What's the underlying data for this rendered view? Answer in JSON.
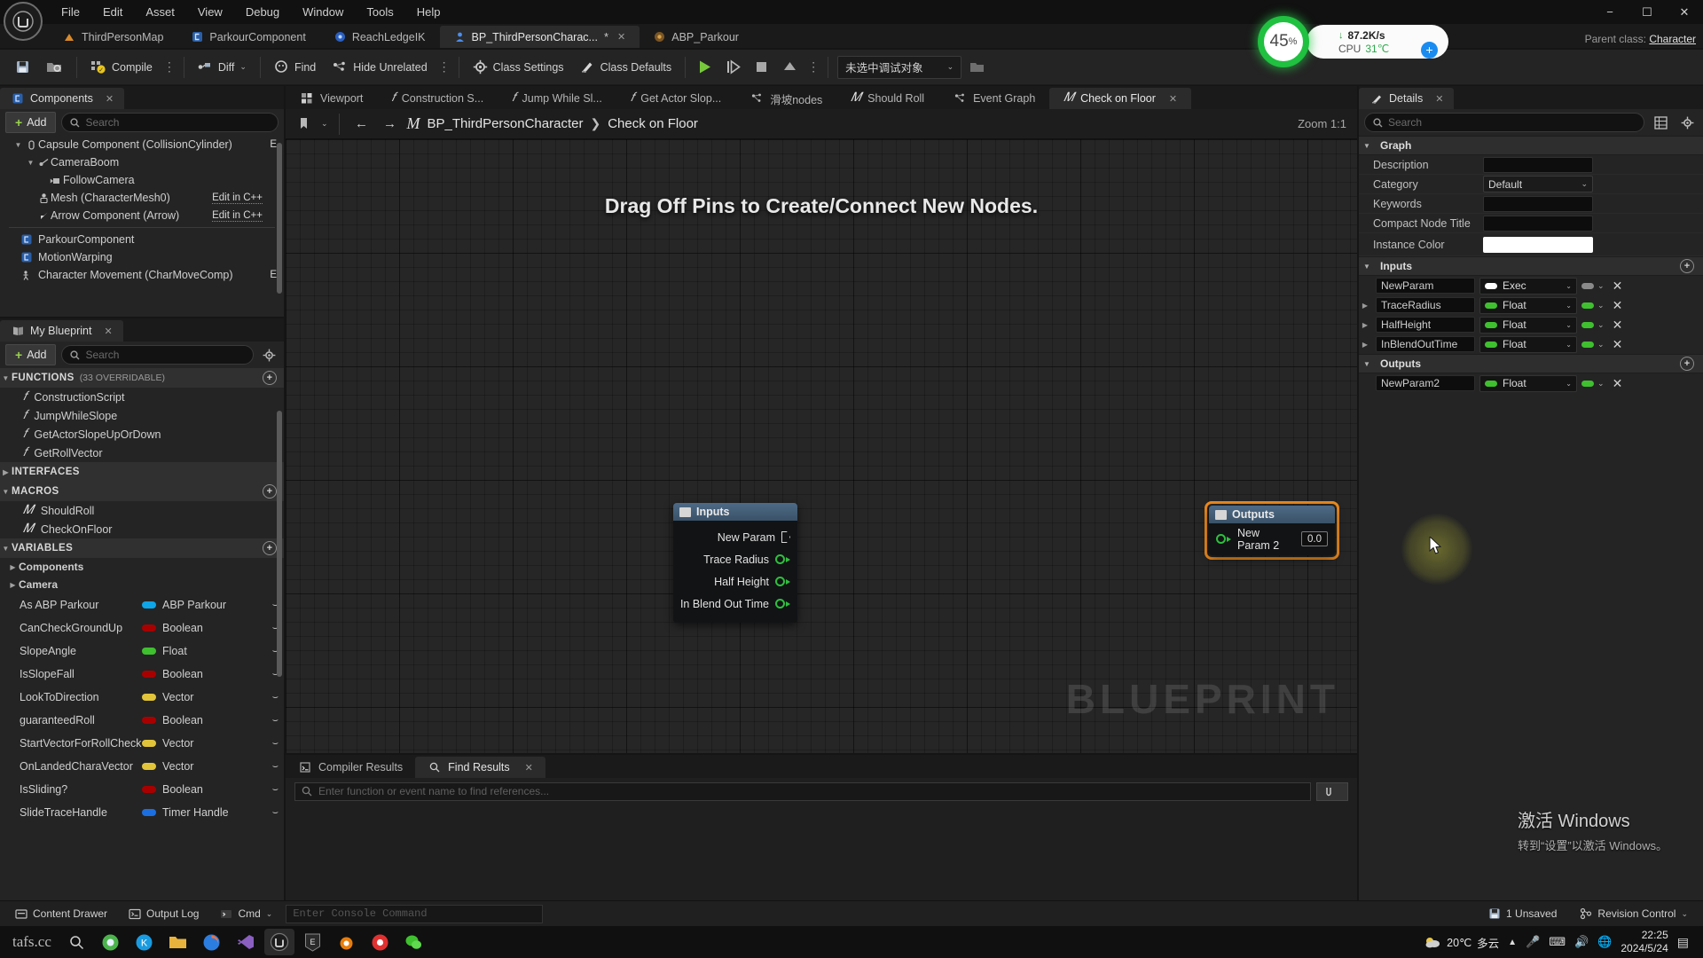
{
  "window": {
    "menu": [
      "File",
      "Edit",
      "Asset",
      "View",
      "Debug",
      "Window",
      "Tools",
      "Help"
    ],
    "minimize": "−",
    "maximize": "☐",
    "close": "✕"
  },
  "asset_tabs": [
    {
      "label": "ThirdPersonMap",
      "icon": "map-icon",
      "active": false,
      "dirty": false
    },
    {
      "label": "ParkourComponent",
      "icon": "blueprint-icon",
      "active": false,
      "dirty": false
    },
    {
      "label": "ReachLedgeIK",
      "icon": "animation-icon",
      "active": false,
      "dirty": false
    },
    {
      "label": "BP_ThirdPersonCharac...",
      "icon": "character-icon",
      "active": true,
      "dirty": true,
      "dirty_mark": "*",
      "close": "✕"
    },
    {
      "label": "ABP_Parkour",
      "icon": "anim-bp-icon",
      "active": false,
      "dirty": false
    }
  ],
  "parent_class": {
    "label": "Parent class:",
    "value": "Character"
  },
  "perf_widget": {
    "cpu_percent": "45",
    "percent_symbol": "%",
    "net_speed": "87.2K/s",
    "net_arrow": "↓",
    "cpu_label": "CPU",
    "cpu_temp": "31℃",
    "plus": "+"
  },
  "toolbar": {
    "save_icon": "save-icon",
    "browse_icon": "browse-content-icon",
    "compile": "Compile",
    "diff": "Diff",
    "find": "Find",
    "hide_unrelated": "Hide Unrelated",
    "class_settings": "Class Settings",
    "class_defaults": "Class Defaults",
    "kebab": "⋮",
    "chevron": "⌄",
    "play": "▶",
    "step": "⏯",
    "stop": "■",
    "eject": "▲",
    "debug_object": "未选中调试对象"
  },
  "components_panel": {
    "tab_label": "Components",
    "tab_close": "✕",
    "add_label": "Add",
    "add_plus": "+",
    "search_placeholder": "Search",
    "items": [
      {
        "label": "Capsule Component (CollisionCylinder)",
        "indent": 1,
        "twisty": "▼",
        "icon": "capsule-icon",
        "edit": "E"
      },
      {
        "label": "CameraBoom",
        "indent": 2,
        "twisty": "▼",
        "icon": "spring-arm-icon",
        "edit": ""
      },
      {
        "label": "FollowCamera",
        "indent": 3,
        "twisty": "",
        "icon": "camera-icon",
        "edit": ""
      },
      {
        "label": "Mesh (CharacterMesh0)",
        "indent": 2,
        "twisty": "",
        "icon": "skeletal-mesh-icon",
        "edit": "Edit in C++"
      },
      {
        "label": "Arrow Component (Arrow)",
        "indent": 2,
        "twisty": "",
        "icon": "arrow-icon",
        "edit": "Edit in C++"
      }
    ],
    "items2": [
      {
        "label": "ParkourComponent",
        "indent": 1,
        "icon": "blueprint-icon",
        "edit": ""
      },
      {
        "label": "MotionWarping",
        "indent": 1,
        "icon": "blueprint-icon",
        "edit": ""
      },
      {
        "label": "Character Movement (CharMoveComp)",
        "indent": 1,
        "icon": "movement-icon",
        "edit": "E"
      }
    ]
  },
  "myblueprint_panel": {
    "tab_label": "My Blueprint",
    "tab_close": "✕",
    "add_label": "Add",
    "add_plus": "+",
    "search_placeholder": "Search",
    "gear_icon": "gear-icon",
    "sections": [
      {
        "title": "FUNCTIONS",
        "sub": "(33 OVERRIDABLE)",
        "caret": "▼",
        "add": "+",
        "items": [
          {
            "label": "ConstructionScript",
            "icon": "f-italic"
          },
          {
            "label": "JumpWhileSlope",
            "icon": "f-italic"
          },
          {
            "label": "GetActorSlopeUpOrDown",
            "icon": "f-italic"
          },
          {
            "label": "GetRollVector",
            "icon": "f-italic"
          }
        ]
      },
      {
        "title": "INTERFACES",
        "sub": "",
        "caret": "▶",
        "add": "",
        "items": []
      },
      {
        "title": "MACROS",
        "sub": "",
        "caret": "▼",
        "add": "+",
        "items": [
          {
            "label": "ShouldRoll",
            "icon": "m-italic"
          },
          {
            "label": "CheckOnFloor",
            "icon": "m-italic"
          }
        ]
      }
    ],
    "variables_header": {
      "title": "VARIABLES",
      "caret": "▼",
      "add": "+"
    },
    "var_groups": [
      {
        "label": "Components",
        "caret": "▶"
      },
      {
        "label": "Camera",
        "caret": "▶"
      }
    ],
    "variables": [
      {
        "name": "As ABP Parkour",
        "type": "ABP Parkour",
        "color": "#0ea5e9",
        "eye": "⌣"
      },
      {
        "name": "CanCheckGroundUp",
        "type": "Boolean",
        "color": "#a80000",
        "eye": "⌣"
      },
      {
        "name": "SlopeAngle",
        "type": "Float",
        "color": "#3fc02f",
        "eye": "⌣"
      },
      {
        "name": "IsSlopeFall",
        "type": "Boolean",
        "color": "#a80000",
        "eye": "⌣"
      },
      {
        "name": "LookToDirection",
        "type": "Vector",
        "color": "#e2c43a",
        "eye": "⌣"
      },
      {
        "name": "guaranteedRoll",
        "type": "Boolean",
        "color": "#a80000",
        "eye": "⌣"
      },
      {
        "name": "StartVectorForRollCheck",
        "type": "Vector",
        "color": "#e2c43a",
        "eye": "⌣"
      },
      {
        "name": "OnLandedCharaVector",
        "type": "Vector",
        "color": "#e2c43a",
        "eye": "⌣"
      },
      {
        "name": "IsSliding?",
        "type": "Boolean",
        "color": "#a80000",
        "eye": "⌣"
      },
      {
        "name": "SlideTraceHandle",
        "type": "Timer Handle",
        "color": "#1c6fe0",
        "eye": "⌣"
      }
    ]
  },
  "graph_tabs": [
    {
      "label": "Viewport",
      "icon": "viewport-icon",
      "active": false
    },
    {
      "label": "Construction S...",
      "icon": "f-italic",
      "active": false
    },
    {
      "label": "Jump While Sl...",
      "icon": "f-italic",
      "active": false
    },
    {
      "label": "Get Actor Slop...",
      "icon": "f-italic",
      "active": false
    },
    {
      "label": "滑坡nodes",
      "icon": "graph-icon",
      "active": false
    },
    {
      "label": "Should Roll",
      "icon": "m-italic",
      "active": false
    },
    {
      "label": "Event Graph",
      "icon": "graph-icon",
      "active": false
    },
    {
      "label": "Check on Floor",
      "icon": "m-italic",
      "active": true,
      "close": "✕"
    }
  ],
  "graph_nav": {
    "bookmark_icon": "bookmark-icon",
    "chevron": "⌄",
    "back": "←",
    "forward": "→",
    "macro_icon": "M",
    "breadcrumb_root": "BP_ThirdPersonCharacter",
    "breadcrumb_sep": "❯",
    "breadcrumb_leaf": "Check on Floor",
    "zoom_label": "Zoom 1:1"
  },
  "graph": {
    "hint": "Drag Off Pins to Create/Connect New Nodes.",
    "watermark": "BLUEPRINT",
    "inputs_node": {
      "title": "Inputs",
      "pins": [
        {
          "label": "New Param",
          "pin": "exec"
        },
        {
          "label": "Trace Radius",
          "pin": "float"
        },
        {
          "label": "Half Height",
          "pin": "float"
        },
        {
          "label": "In Blend Out Time",
          "pin": "float"
        }
      ]
    },
    "outputs_node": {
      "title": "Outputs",
      "selected": true,
      "pins": [
        {
          "label": "New Param 2",
          "pin": "float",
          "value": "0.0"
        }
      ]
    }
  },
  "results_panel": {
    "tabs": [
      {
        "label": "Compiler Results",
        "icon": "compiler-icon",
        "active": false
      },
      {
        "label": "Find Results",
        "icon": "search-icon",
        "active": true,
        "close": "✕"
      }
    ],
    "find_placeholder": "Enter function or event name to find references...",
    "find_button_icon": "find-all-icon"
  },
  "details_panel": {
    "tab_label": "Details",
    "tab_close": "✕",
    "search_placeholder": "Search",
    "grid_icon": "grid-view-icon",
    "gear_icon": "settings-gear-icon",
    "graph_section": {
      "title": "Graph",
      "caret": "▼",
      "rows": [
        {
          "label": "Description",
          "kind": "text",
          "value": ""
        },
        {
          "label": "Category",
          "kind": "combo",
          "value": "Default"
        },
        {
          "label": "Keywords",
          "kind": "text",
          "value": ""
        },
        {
          "label": "Compact Node Title",
          "kind": "text",
          "value": ""
        },
        {
          "label": "Instance Color",
          "kind": "color",
          "value": "#ffffff"
        }
      ]
    },
    "inputs_section": {
      "title": "Inputs",
      "caret": "▼",
      "add": "+",
      "params": [
        {
          "name": "NewParam",
          "type": "Exec",
          "color": "#ffffff",
          "mini_color": "#8a8a8a",
          "caret": "",
          "x": "✕"
        },
        {
          "name": "TraceRadius",
          "type": "Float",
          "color": "#3fc02f",
          "mini_color": "#3fc02f",
          "caret": "▶",
          "x": "✕"
        },
        {
          "name": "HalfHeight",
          "type": "Float",
          "color": "#3fc02f",
          "mini_color": "#3fc02f",
          "caret": "▶",
          "x": "✕"
        },
        {
          "name": "InBlendOutTime",
          "type": "Float",
          "color": "#3fc02f",
          "mini_color": "#3fc02f",
          "caret": "▶",
          "x": "✕"
        }
      ]
    },
    "outputs_section": {
      "title": "Outputs",
      "caret": "▼",
      "add": "+",
      "params": [
        {
          "name": "NewParam2",
          "type": "Float",
          "color": "#3fc02f",
          "mini_color": "#3fc02f",
          "caret": "",
          "x": "✕"
        }
      ]
    }
  },
  "windows_activate": {
    "line1": "激活 Windows",
    "line2": "转到“设置”以激活 Windows。"
  },
  "statusbar": {
    "content_drawer": "Content Drawer",
    "output_log": "Output Log",
    "cmd_label": "Cmd",
    "cmd_chevron": "⌄",
    "cmd_placeholder": "Enter Console Command",
    "unsaved": "1 Unsaved",
    "revision_control": "Revision Control",
    "revision_chevron": "⌄"
  },
  "taskbar": {
    "start_label": "tafs.cc",
    "search_icon": "search-icon",
    "items": [
      {
        "name": "chrome-icon",
        "glyph": "●",
        "color": "#4db34d"
      },
      {
        "name": "kugou-icon",
        "glyph": "K",
        "color": "#1a9be0"
      },
      {
        "name": "explorer-icon",
        "glyph": "▤",
        "color": "#e8b33c"
      },
      {
        "name": "firefox-icon",
        "glyph": "◐",
        "color": "#ff7139"
      },
      {
        "name": "visual-studio-icon",
        "glyph": "∞",
        "color": "#8a5fc0"
      },
      {
        "name": "unreal-icon",
        "glyph": "ⓤ",
        "color": "#dcdcdc"
      },
      {
        "name": "epic-games-icon",
        "glyph": "E",
        "color": "#cfcfcf"
      },
      {
        "name": "blender-icon",
        "glyph": "◉",
        "color": "#e87d0d"
      },
      {
        "name": "recorder-icon",
        "glyph": "●",
        "color": "#e03131"
      },
      {
        "name": "wechat-icon",
        "glyph": "✉",
        "color": "#3fc02f"
      }
    ],
    "weather": {
      "temp": "20℃",
      "desc": "多云",
      "icon": "cloudy-icon"
    },
    "tray_icons": [
      "▲",
      "🎤",
      "⌨",
      "🔊",
      "🌐"
    ],
    "time": "22:25",
    "date": "2024/5/24",
    "notify_icon": "notification-icon"
  }
}
